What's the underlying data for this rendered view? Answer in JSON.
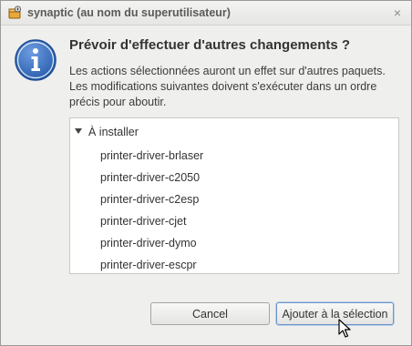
{
  "window": {
    "title": "synaptic (au nom du superutilisateur)",
    "close_glyph": "×",
    "app_icon": "synaptic-package-icon"
  },
  "dialog": {
    "icon": "info-icon",
    "heading": "Prévoir d'effectuer d'autres changements ?",
    "description": "Les actions sélectionnées auront un effet sur d'autres paquets. Les modifications suivantes doivent s'exécuter dans un ordre précis pour aboutir.",
    "tree": {
      "group_label": "À installer",
      "items": [
        "printer-driver-brlaser",
        "printer-driver-c2050",
        "printer-driver-c2esp",
        "printer-driver-cjet",
        "printer-driver-dymo",
        "printer-driver-escpr"
      ]
    }
  },
  "buttons": {
    "cancel": "Cancel",
    "add": "Ajouter à la sélection"
  },
  "colors": {
    "info_blue": "#3f74c4",
    "focus_border": "#6b94c9"
  }
}
